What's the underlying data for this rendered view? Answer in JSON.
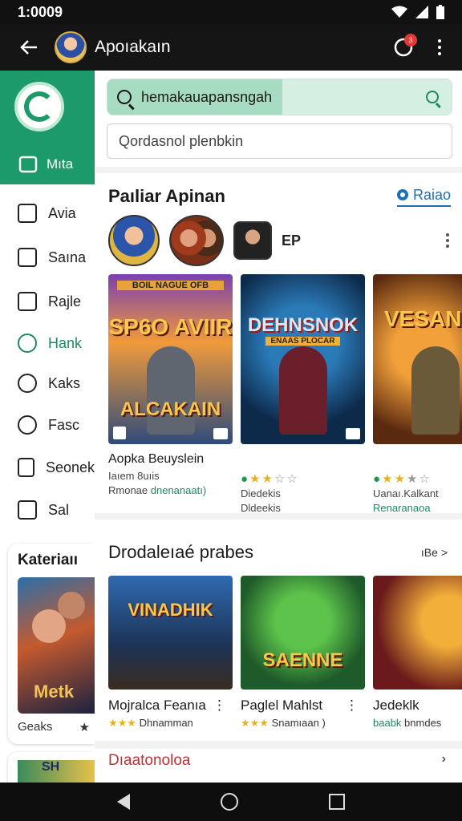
{
  "status": {
    "time": "1:0009",
    "icons": [
      "wifi-icon",
      "signal-icon",
      "battery-icon"
    ]
  },
  "app_bar": {
    "title": "Apoıakaın",
    "notification_count": "3"
  },
  "sidebar": {
    "active": "Mıta",
    "items": [
      {
        "label": "Avia",
        "icon": "home-icon"
      },
      {
        "label": "Saına",
        "icon": "upload-icon"
      },
      {
        "label": "Rajle",
        "icon": "chart-icon"
      },
      {
        "label": "Hank",
        "icon": "chat-icon"
      },
      {
        "label": "Kaks",
        "icon": "clock-icon"
      },
      {
        "label": "Fasc",
        "icon": "timer-icon"
      },
      {
        "label": "Seonek",
        "icon": "edit-icon"
      },
      {
        "label": "Sal",
        "icon": "list-icon"
      }
    ],
    "card": {
      "title": "Kateriaıı",
      "art_text": "Metk",
      "caption": "Geaks",
      "star": "★"
    },
    "card2": {
      "art_text": "SH"
    }
  },
  "search": {
    "value": "hemakauapansngah",
    "placeholder": "Qordasnol plenbkin"
  },
  "section1": {
    "title": "Paıliar Apinan",
    "link": "Raiao",
    "avatar_badge": "EP",
    "games": [
      {
        "art_text": "SP6O AVIIR",
        "art_sub": "ALCAKAIN",
        "top_text": "BOIL NAGUE OFB",
        "name": "Aopka Beuyslein",
        "rating_text": "Iaıem 8uıis",
        "sub2": "Rmonae",
        "sub2_green": "dnenanaatı)"
      },
      {
        "art_text": "DEHNSNOK",
        "art_sub": "",
        "top_text": "ENAAS PLOCAR",
        "name": "",
        "rating_text": "Diedekis",
        "sub2": "Dldeekis",
        "sub2_green": ""
      },
      {
        "art_text": "VESANC",
        "art_sub": "",
        "top_text": "",
        "name": "",
        "rating_text": "Uanaı.Kalkant",
        "sub2": "",
        "sub2_green": "Renaranaoa"
      }
    ]
  },
  "section2": {
    "title": "Drodaleıaé prabes",
    "more": "ıBe",
    "games": [
      {
        "art_text": "VINADHIK",
        "name": "Mojralca Feanıa",
        "stars": "★★★",
        "sub": "Dhnamman"
      },
      {
        "art_text": "SAENNE",
        "name": "Paglel Mahlst",
        "stars": "★★★",
        "sub": "Snamıaan )"
      },
      {
        "art_text": "",
        "name": "Jedeklk",
        "stars": "",
        "sub_green": "baabk",
        "sub": "bnmdes"
      }
    ]
  },
  "section3": {
    "title": "Dıaatonoloa"
  },
  "colors": {
    "brand_green": "#1c9a6a",
    "link_blue": "#1e6fb8",
    "star_yellow": "#e7b21c",
    "badge_red": "#e53935"
  }
}
